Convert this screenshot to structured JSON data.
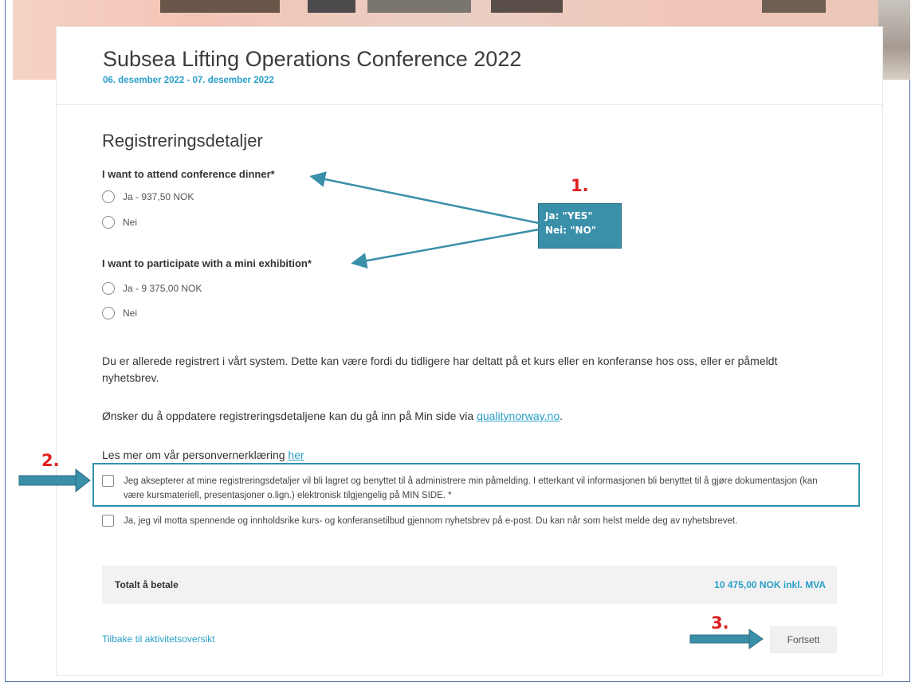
{
  "event": {
    "title": "Subsea Lifting Operations Conference 2022",
    "dates": "06. desember 2022 - 07. desember 2022"
  },
  "section_title": "Registreringsdetaljer",
  "questions": [
    {
      "label": "I want to attend conference dinner*",
      "options": [
        "Ja - 937,50 NOK",
        "Nei"
      ]
    },
    {
      "label": "I want to participate with a mini exhibition*",
      "options": [
        "Ja - 9 375,00 NOK",
        "Nei"
      ]
    }
  ],
  "info": {
    "registered_text": "Du er allerede registrert i vårt system. Dette kan være fordi du tidligere har deltatt på et kurs eller en konferanse hos oss, eller er påmeldt nyhetsbrev.",
    "update_text": "Ønsker du å oppdatere registreringsdetaljene kan du gå inn på Min side via ",
    "update_link": "qualitynorway.no",
    "update_suffix": ".",
    "privacy_text": "Les mer om vår personvernerklæring ",
    "privacy_link": "her"
  },
  "consents": [
    "Jeg aksepterer at mine registreringsdetaljer vil bli lagret og benyttet til å administrere min påmelding. I etterkant vil informasjonen bli benyttet til å gjøre dokumentasjon (kan være kursmateriell, presentasjoner o.lign.) elektronisk tilgjengelig på MIN SIDE. *",
    "Ja, jeg vil motta spennende og innholdsrike kurs- og konferansetilbud gjennom nyhetsbrev på e-post. Du kan når som helst melde deg av nyhetsbrevet."
  ],
  "total": {
    "label": "Totalt å betale",
    "amount": "10 475,00 NOK inkl. MVA"
  },
  "footer": {
    "back_link": "Tilbake til aktivitetsoversikt",
    "continue_label": "Fortsett"
  },
  "annotations": {
    "marker_1": "1.",
    "marker_2": "2.",
    "marker_3": "3.",
    "callout_line1": "Ja: \"YES\"",
    "callout_line2": "Nei: \"NO\"",
    "annotation_color": "#3a8fa9",
    "marker_color": "#e02020"
  },
  "colors": {
    "accent": "#2a9fc9",
    "total_bar": "#f2f2f2"
  }
}
